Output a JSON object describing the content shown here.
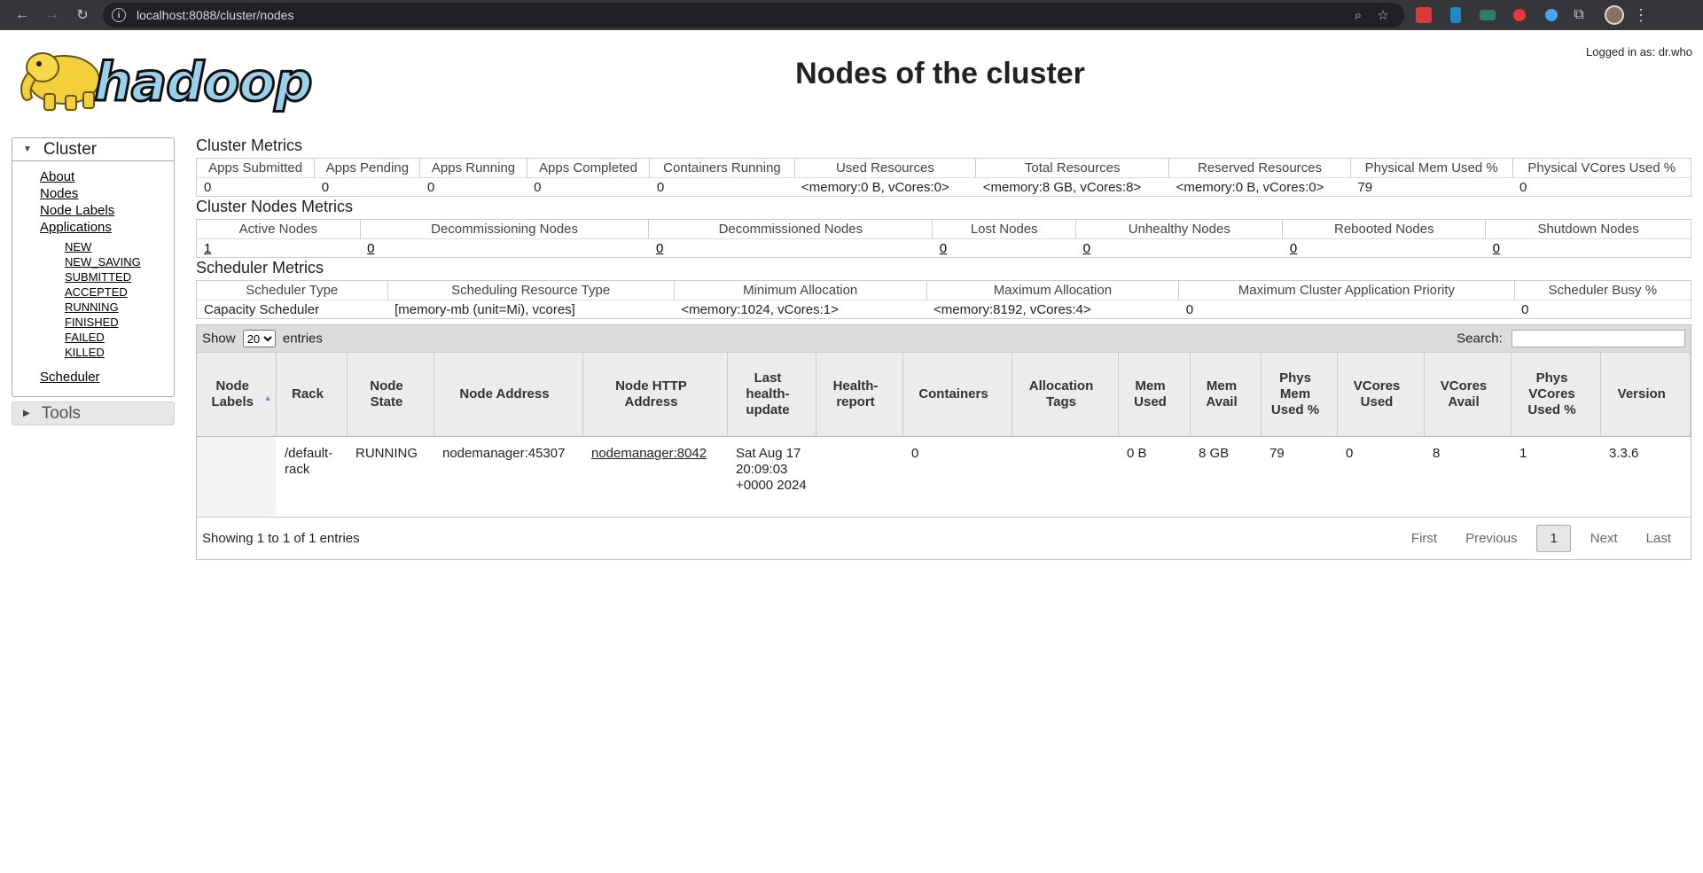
{
  "browser": {
    "url": "localhost:8088/cluster/nodes",
    "back_glyph": "←",
    "forward_glyph": "→",
    "reload_glyph": "↻",
    "info_glyph": "i",
    "zoom_glyph": "⌕",
    "star_glyph": "☆",
    "puzzle_glyph": "⧉",
    "menu_glyph": "⋮"
  },
  "header": {
    "logo_text": "hadoop",
    "title": "Nodes of the cluster",
    "login": "Logged in as: dr.who"
  },
  "sidebar": {
    "cluster": {
      "label": "Cluster",
      "toggle": "▼",
      "links": [
        "About",
        "Nodes",
        "Node Labels",
        "Applications"
      ],
      "app_states": [
        "NEW",
        "NEW_SAVING",
        "SUBMITTED",
        "ACCEPTED",
        "RUNNING",
        "FINISHED",
        "FAILED",
        "KILLED"
      ],
      "scheduler": "Scheduler"
    },
    "tools": {
      "label": "Tools",
      "toggle": "▶"
    }
  },
  "cluster_metrics": {
    "title": "Cluster Metrics",
    "headers": [
      "Apps Submitted",
      "Apps Pending",
      "Apps Running",
      "Apps Completed",
      "Containers Running",
      "Used Resources",
      "Total Resources",
      "Reserved Resources",
      "Physical Mem Used %",
      "Physical VCores Used %"
    ],
    "values": [
      "0",
      "0",
      "0",
      "0",
      "0",
      "<memory:0 B, vCores:0>",
      "<memory:8 GB, vCores:8>",
      "<memory:0 B, vCores:0>",
      "79",
      "0"
    ]
  },
  "node_metrics": {
    "title": "Cluster Nodes Metrics",
    "headers": [
      "Active Nodes",
      "Decommissioning Nodes",
      "Decommissioned Nodes",
      "Lost Nodes",
      "Unhealthy Nodes",
      "Rebooted Nodes",
      "Shutdown Nodes"
    ],
    "values": [
      "1",
      "0",
      "0",
      "0",
      "0",
      "0",
      "0"
    ]
  },
  "scheduler_metrics": {
    "title": "Scheduler Metrics",
    "headers": [
      "Scheduler Type",
      "Scheduling Resource Type",
      "Minimum Allocation",
      "Maximum Allocation",
      "Maximum Cluster Application Priority",
      "Scheduler Busy %"
    ],
    "values": [
      "Capacity Scheduler",
      "[memory-mb (unit=Mi), vcores]",
      "<memory:1024, vCores:1>",
      "<memory:8192, vCores:4>",
      "0",
      "0"
    ]
  },
  "table": {
    "show_label": "Show",
    "entries_label": "entries",
    "page_size": "20",
    "page_size_options": [
      "20"
    ],
    "search_label": "Search:",
    "search_value": "",
    "sort_glyph": "▲",
    "headers": [
      "Node Labels",
      "Rack",
      "Node State",
      "Node Address",
      "Node HTTP Address",
      "Last health-update",
      "Health-report",
      "Containers",
      "Allocation Tags",
      "Mem Used",
      "Mem Avail",
      "Phys Mem Used %",
      "VCores Used",
      "VCores Avail",
      "Phys VCores Used %",
      "Version"
    ],
    "rows": [
      [
        "",
        "/default-rack",
        "RUNNING",
        "nodemanager:45307",
        "nodemanager:8042",
        "Sat Aug 17 20:09:03 +0000 2024",
        "",
        "0",
        "",
        "0 B",
        "8 GB",
        "79",
        "0",
        "8",
        "1",
        "3.3.6"
      ]
    ],
    "info": "Showing 1 to 1 of 1 entries",
    "pager": {
      "first": "First",
      "previous": "Previous",
      "current": "1",
      "next": "Next",
      "last": "Last"
    }
  }
}
